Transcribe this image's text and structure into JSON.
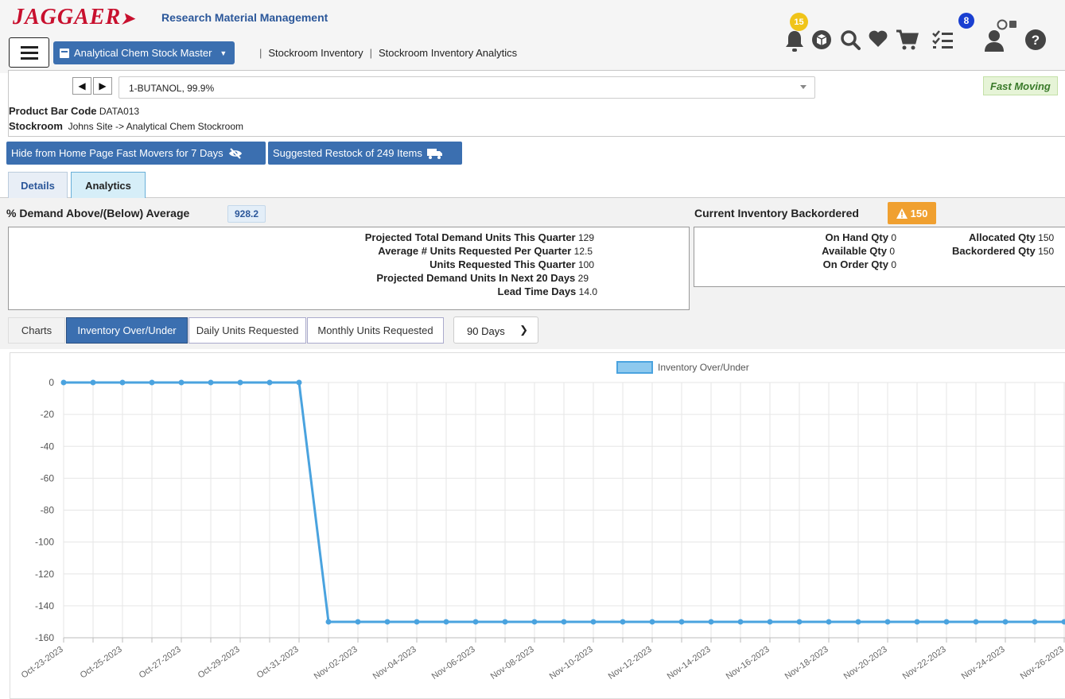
{
  "header": {
    "logo": "JAGGAER",
    "app_title": "Research Material Management",
    "scope_button": "Analytical Chem Stock Master",
    "breadcrumbs": [
      "Stockroom Inventory",
      "Stockroom Inventory Analytics"
    ],
    "notification_count": "15",
    "tasks_count": "8",
    "icons": [
      "menu-icon",
      "bell-icon",
      "box-icon",
      "search-icon",
      "heart-icon",
      "cart-icon",
      "checklist-icon",
      "user-icon",
      "help-icon"
    ]
  },
  "product": {
    "selected": "1-BUTANOL, 99.9%",
    "tag": "Fast Moving",
    "bar_code_label": "Product Bar Code",
    "bar_code": "DATA013",
    "stockroom_label": "Stockroom",
    "stockroom": "Johns Site -> Analytical Chem Stockroom"
  },
  "actions": {
    "hide_label": "Hide from Home Page Fast Movers for 7 Days",
    "restock_label": "Suggested Restock of 249 Items"
  },
  "tabs": [
    "Details",
    "Analytics"
  ],
  "active_tab": "Analytics",
  "demand": {
    "title": "% Demand Above/(Below) Average",
    "value": "928.2",
    "rows": [
      {
        "label": "Projected Total Demand Units This Quarter",
        "value": "129"
      },
      {
        "label": "Average # Units Requested Per Quarter",
        "value": "12.5"
      },
      {
        "label": "Units Requested This Quarter",
        "value": "100"
      },
      {
        "label": "Projected Demand Units In Next 20 Days",
        "value": "29"
      },
      {
        "label": "Lead Time Days",
        "value": "14.0"
      }
    ]
  },
  "inventory": {
    "title": "Current Inventory Backordered",
    "badge": "150",
    "left": [
      {
        "label": "On Hand Qty",
        "value": "0"
      },
      {
        "label": "Available Qty",
        "value": "0"
      },
      {
        "label": "On Order Qty",
        "value": "0"
      }
    ],
    "right": [
      {
        "label": "Allocated Qty",
        "value": "150"
      },
      {
        "label": "Backordered Qty",
        "value": "150"
      }
    ]
  },
  "chart_tabs": {
    "charts_label": "Charts",
    "items": [
      "Inventory Over/Under",
      "Daily Units Requested",
      "Monthly Units Requested"
    ],
    "active": "Inventory Over/Under",
    "range": "90 Days"
  },
  "colors": {
    "primary": "#3b6fb0",
    "line": "#4aa3df",
    "fast_moving_bg": "#e6f4d7",
    "warning": "#f0a030"
  },
  "chart_data": {
    "type": "line",
    "legend": "Inventory Over/Under",
    "legend_position": "top-center",
    "grid": true,
    "ylim": [
      -160,
      0
    ],
    "yticks": [
      0,
      -20,
      -40,
      -60,
      -80,
      -100,
      -120,
      -140,
      -160
    ],
    "x": [
      "Oct-23-2023",
      "Oct-24-2023",
      "Oct-25-2023",
      "Oct-26-2023",
      "Oct-27-2023",
      "Oct-28-2023",
      "Oct-29-2023",
      "Oct-30-2023",
      "Oct-31-2023",
      "Nov-01-2023",
      "Nov-02-2023",
      "Nov-03-2023",
      "Nov-04-2023",
      "Nov-05-2023",
      "Nov-06-2023",
      "Nov-07-2023",
      "Nov-08-2023",
      "Nov-09-2023",
      "Nov-10-2023",
      "Nov-11-2023",
      "Nov-12-2023",
      "Nov-13-2023",
      "Nov-14-2023",
      "Nov-15-2023",
      "Nov-16-2023",
      "Nov-17-2023",
      "Nov-18-2023",
      "Nov-19-2023",
      "Nov-20-2023",
      "Nov-21-2023",
      "Nov-22-2023",
      "Nov-23-2023",
      "Nov-24-2023",
      "Nov-25-2023",
      "Nov-26-2023"
    ],
    "x_tick_labels": [
      "Oct-23-2023",
      "Oct-25-2023",
      "Oct-27-2023",
      "Oct-29-2023",
      "Oct-31-2023",
      "Nov-02-2023",
      "Nov-04-2023",
      "Nov-06-2023",
      "Nov-08-2023",
      "Nov-10-2023",
      "Nov-12-2023",
      "Nov-14-2023",
      "Nov-16-2023",
      "Nov-18-2023",
      "Nov-20-2023",
      "Nov-22-2023",
      "Nov-24-2023",
      "Nov-26-2023"
    ],
    "series": [
      {
        "name": "Inventory Over/Under",
        "values": [
          0,
          0,
          0,
          0,
          0,
          0,
          0,
          0,
          0,
          -150,
          -150,
          -150,
          -150,
          -150,
          -150,
          -150,
          -150,
          -150,
          -150,
          -150,
          -150,
          -150,
          -150,
          -150,
          -150,
          -150,
          -150,
          -150,
          -150,
          -150,
          -150,
          -150,
          -150,
          -150,
          -150
        ]
      }
    ]
  }
}
